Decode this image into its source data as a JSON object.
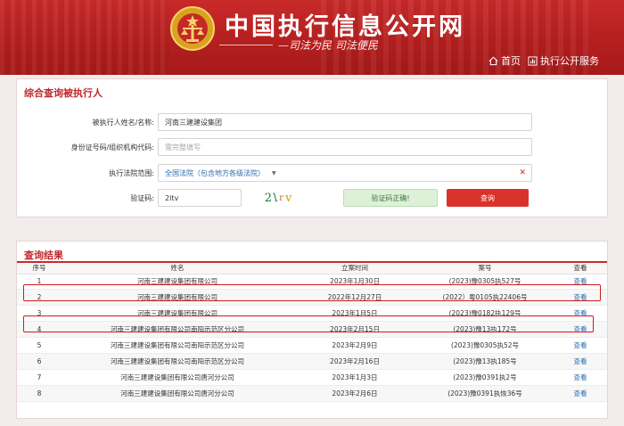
{
  "header": {
    "site_title": "中国执行信息公开网",
    "slogan": "—司法为民  司法便民",
    "nav": [
      {
        "label": "首页",
        "icon": "home-icon"
      },
      {
        "label": "执行公开服务",
        "icon": "chart-icon"
      }
    ]
  },
  "search": {
    "title": "综合查询被执行人",
    "name_label": "被执行人姓名/名称:",
    "name_value": "河南三建建设集团",
    "id_label": "身份证号码/组织机构代码:",
    "id_placeholder": "需完整填写",
    "court_label": "执行法院范围:",
    "court_value": "全国法院（包含地方各级法院）",
    "captcha_label": "验证码:",
    "captcha_value": "2ltv",
    "captcha_image_text": "2lrv",
    "captcha_ok_label": "验证码正确!",
    "search_button": "查询"
  },
  "results": {
    "title": "查询结果",
    "columns": [
      "序号",
      "姓名",
      "立案时间",
      "案号",
      "查看"
    ],
    "rows": [
      {
        "no": "1",
        "name": "河南三建建设集团有限公司",
        "date": "2023年1月30日",
        "case": "(2023)豫0305执527号",
        "view": "查看"
      },
      {
        "no": "2",
        "name": "河南三建建设集团有限公司",
        "date": "2022年12月27日",
        "case": "(2022）粤0105执22406号",
        "view": "查看"
      },
      {
        "no": "3",
        "name": "河南三建建设集团有限公司",
        "date": "2023年1月5日",
        "case": "(2023)豫0182执129号",
        "view": "查看"
      },
      {
        "no": "4",
        "name": "河南三建建设集团有限公司南阳示范区分公司",
        "date": "2023年2月15日",
        "case": "(2023)豫13执172号",
        "view": "查看"
      },
      {
        "no": "5",
        "name": "河南三建建设集团有限公司南阳示范区分公司",
        "date": "2023年2月9日",
        "case": "(2023)豫0305执52号",
        "view": "查看"
      },
      {
        "no": "6",
        "name": "河南三建建设集团有限公司南阳示范区分公司",
        "date": "2023年2月16日",
        "case": "(2023)豫13执185号",
        "view": "查看"
      },
      {
        "no": "7",
        "name": "河南三建建设集团有限公司唐河分公司",
        "date": "2023年1月3日",
        "case": "(2023)豫0391执2号",
        "view": "查看"
      },
      {
        "no": "8",
        "name": "河南三建建设集团有限公司唐河分公司",
        "date": "2023年2月6日",
        "case": "(2023)豫0391执恢36号",
        "view": "查看"
      }
    ]
  },
  "colors": {
    "header_red": "#c92a2a",
    "accent_red": "#c0282d",
    "link_blue": "#2d6cb0",
    "highlight_red": "#d21919"
  }
}
